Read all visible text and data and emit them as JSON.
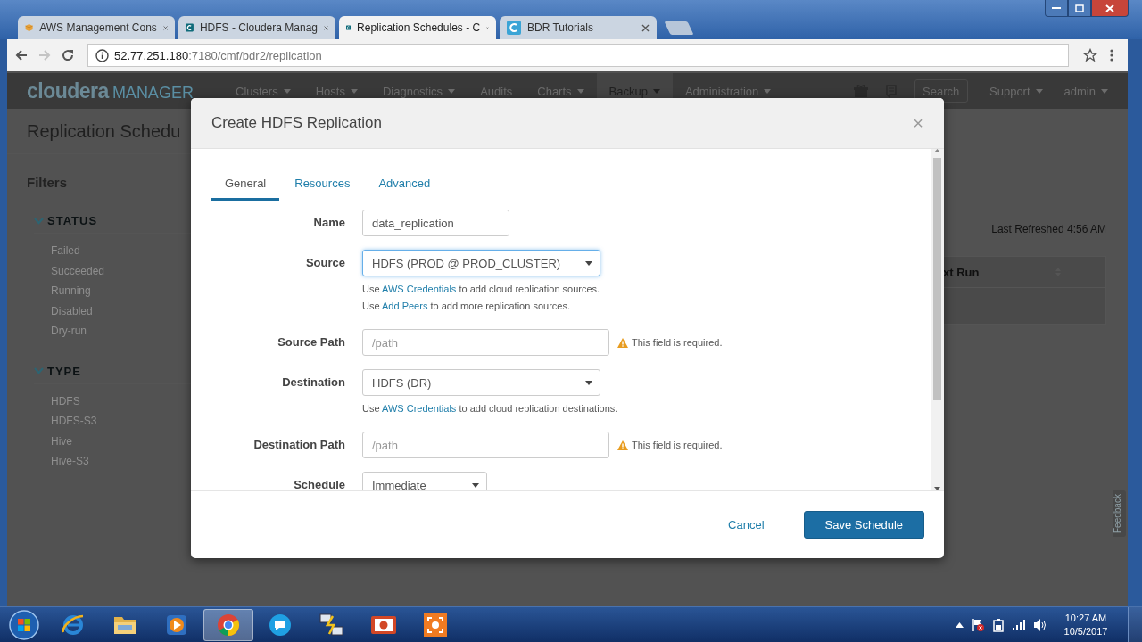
{
  "browser": {
    "tabs": [
      {
        "kind": "aws",
        "title": "AWS Management Cons",
        "selected": false
      },
      {
        "kind": "cloudera",
        "title": "HDFS - Cloudera Manag",
        "selected": false
      },
      {
        "kind": "cloudera",
        "title": "Replication Schedules - C",
        "selected": true
      },
      {
        "kind": "tutorial",
        "title": "BDR Tutorials",
        "selected": false
      }
    ],
    "address": {
      "host": "52.77.251.180",
      "path": ":7180/cmf/bdr2/replication"
    }
  },
  "app": {
    "logo": {
      "brand": "cloudera",
      "product": "MANAGER"
    },
    "nav": [
      {
        "label": "Clusters",
        "dropdown": true,
        "selected": false
      },
      {
        "label": "Hosts",
        "dropdown": true,
        "selected": false
      },
      {
        "label": "Diagnostics",
        "dropdown": true,
        "selected": false
      },
      {
        "label": "Audits",
        "dropdown": false,
        "selected": false
      },
      {
        "label": "Charts",
        "dropdown": true,
        "selected": false
      },
      {
        "label": "Backup",
        "dropdown": true,
        "selected": true
      },
      {
        "label": "Administration",
        "dropdown": true,
        "selected": false
      }
    ],
    "search": {
      "placeholder": "Search"
    },
    "menus": [
      {
        "label": "Support"
      },
      {
        "label": "admin"
      }
    ]
  },
  "page": {
    "title": "Replication Schedu",
    "filters": {
      "title": "Filters",
      "groups": [
        {
          "title": "STATUS",
          "expanded": true,
          "items": [
            "Failed",
            "Succeeded",
            "Running",
            "Disabled",
            "Dry-run"
          ]
        },
        {
          "title": "TYPE",
          "expanded": true,
          "items": [
            "HDFS",
            "HDFS-S3",
            "Hive",
            "Hive-S3"
          ]
        }
      ]
    },
    "last_refreshed": "Last Refreshed 4:56 AM",
    "table": {
      "columns": [
        "xt Run"
      ]
    },
    "feedback": "Feedback"
  },
  "dialog": {
    "title": "Create HDFS Replication",
    "close": "×",
    "tabs": [
      {
        "label": "General",
        "selected": true
      },
      {
        "label": "Resources",
        "selected": false
      },
      {
        "label": "Advanced",
        "selected": false
      }
    ],
    "fields": [
      {
        "kind": "text",
        "label": "Name",
        "value": "data_replication"
      },
      {
        "kind": "select",
        "label": "Source",
        "value": "HDFS (PROD @ PROD_CLUSTER)",
        "focused": true,
        "help": [
          {
            "before": "Use",
            "link": "AWS Credentials",
            "after": "to add cloud replication sources."
          },
          {
            "before": "Use",
            "link": "Add Peers",
            "after": "to add more replication sources."
          }
        ]
      },
      {
        "kind": "text",
        "label": "Source Path",
        "placeholder": "/path",
        "error": "This field is required."
      },
      {
        "kind": "select",
        "label": "Destination",
        "value": "HDFS (DR)",
        "focused": false,
        "help": [
          {
            "before": "Use",
            "link": "AWS Credentials",
            "after": "to add cloud replication destinations."
          }
        ]
      },
      {
        "kind": "text",
        "label": "Destination Path",
        "placeholder": "/path",
        "error": "This field is required."
      },
      {
        "kind": "select",
        "label": "Schedule",
        "value": "Immediate",
        "focused": false
      }
    ],
    "buttons": [
      {
        "kind": "link",
        "label": "Cancel"
      },
      {
        "kind": "primary",
        "label": "Save Schedule"
      }
    ]
  },
  "taskbar": {
    "apps": [
      {
        "kind": "ie",
        "active": false
      },
      {
        "kind": "explorer",
        "active": false
      },
      {
        "kind": "media",
        "active": false
      },
      {
        "kind": "chrome",
        "active": true
      },
      {
        "kind": "skype",
        "active": false
      },
      {
        "kind": "network",
        "active": false
      },
      {
        "kind": "presentation",
        "active": false
      },
      {
        "kind": "recorder",
        "active": false
      }
    ],
    "time": "10:27 AM",
    "date": "10/5/2017"
  }
}
